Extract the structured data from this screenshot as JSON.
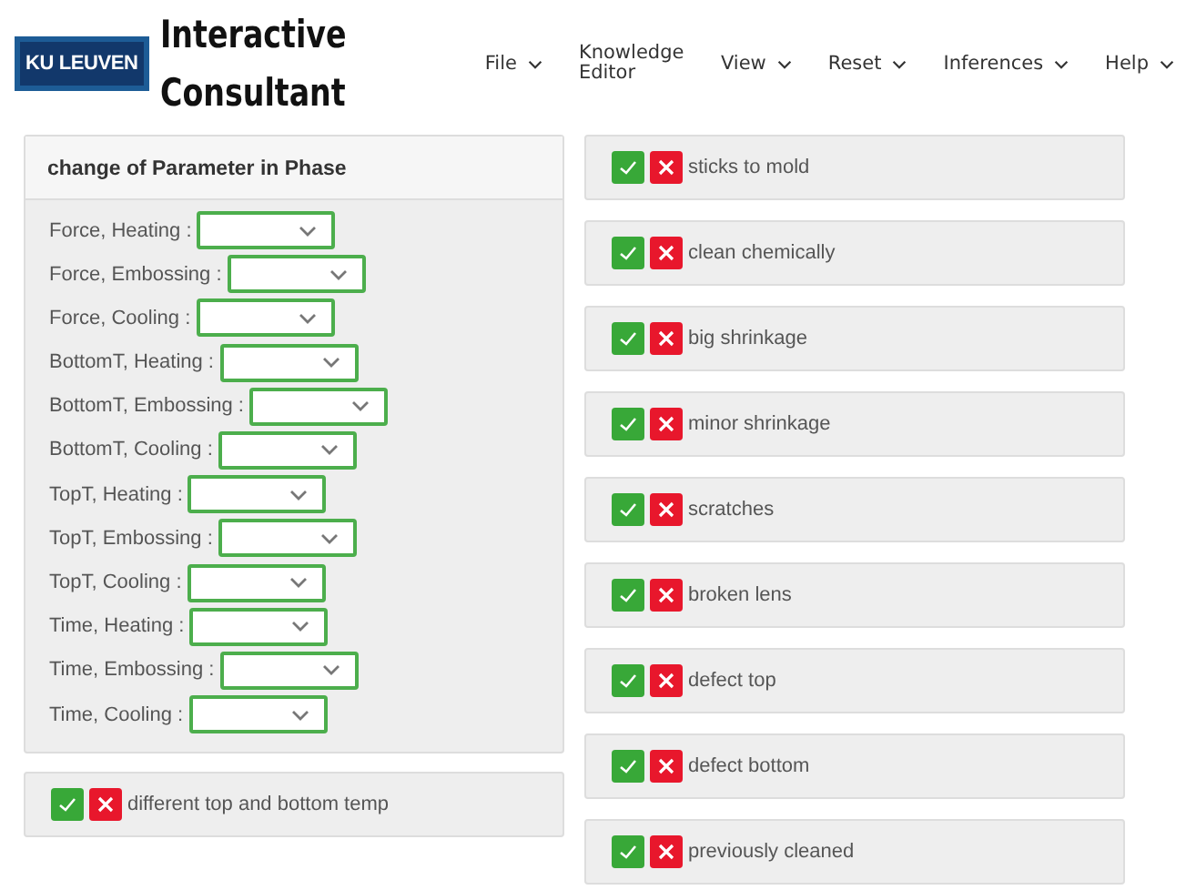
{
  "logo": {
    "text": "KU LEUVEN"
  },
  "app_title": [
    "Interactive",
    "Consultant"
  ],
  "menu": [
    {
      "label": "File",
      "dropdown": true
    },
    {
      "label": "Knowledge Editor",
      "dropdown": false
    },
    {
      "label": "View",
      "dropdown": true
    },
    {
      "label": "Reset",
      "dropdown": true
    },
    {
      "label": "Inferences",
      "dropdown": true
    },
    {
      "label": "Help",
      "dropdown": true
    }
  ],
  "parameter_panel": {
    "title": "change of Parameter in Phase",
    "fields": [
      {
        "label": "Force, Heating :"
      },
      {
        "label": "Force, Embossing :"
      },
      {
        "label": "Force, Cooling :"
      },
      {
        "label": "BottomT, Heating :"
      },
      {
        "label": "BottomT, Embossing :"
      },
      {
        "label": "BottomT, Cooling :"
      },
      {
        "label": "TopT, Heating :"
      },
      {
        "label": "TopT, Embossing :"
      },
      {
        "label": "TopT, Cooling :"
      },
      {
        "label": "Time, Heating :"
      },
      {
        "label": "Time, Embossing :"
      },
      {
        "label": "Time, Cooling :"
      }
    ]
  },
  "left_questions": [
    {
      "label": "different top and bottom temp"
    }
  ],
  "right_questions": [
    {
      "label": "sticks to mold"
    },
    {
      "label": "clean chemically"
    },
    {
      "label": "big shrinkage"
    },
    {
      "label": "minor shrinkage"
    },
    {
      "label": "scratches"
    },
    {
      "label": "broken lens"
    },
    {
      "label": "defect top"
    },
    {
      "label": "defect bottom"
    },
    {
      "label": "previously cleaned"
    }
  ]
}
